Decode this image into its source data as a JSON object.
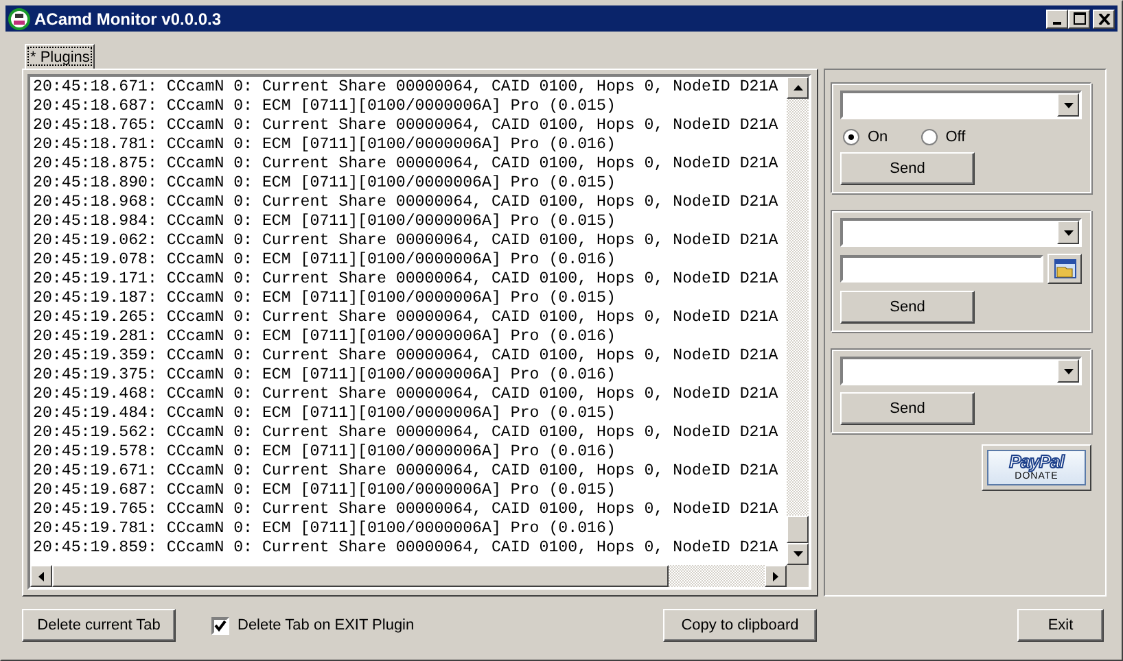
{
  "window": {
    "title": "ACamd Monitor v0.0.0.3"
  },
  "tabs": [
    {
      "label": "* Plugins",
      "selected": true
    }
  ],
  "log_lines": [
    "20:45:18.671: CCcamN 0: Current Share 00000064, CAID 0100, Hops 0, NodeID D21A",
    "20:45:18.687: CCcamN 0: ECM [0711][0100/0000006A] Pro (0.015)",
    "20:45:18.765: CCcamN 0: Current Share 00000064, CAID 0100, Hops 0, NodeID D21A",
    "20:45:18.781: CCcamN 0: ECM [0711][0100/0000006A] Pro (0.016)",
    "20:45:18.875: CCcamN 0: Current Share 00000064, CAID 0100, Hops 0, NodeID D21A",
    "20:45:18.890: CCcamN 0: ECM [0711][0100/0000006A] Pro (0.015)",
    "20:45:18.968: CCcamN 0: Current Share 00000064, CAID 0100, Hops 0, NodeID D21A",
    "20:45:18.984: CCcamN 0: ECM [0711][0100/0000006A] Pro (0.015)",
    "20:45:19.062: CCcamN 0: Current Share 00000064, CAID 0100, Hops 0, NodeID D21A",
    "20:45:19.078: CCcamN 0: ECM [0711][0100/0000006A] Pro (0.016)",
    "20:45:19.171: CCcamN 0: Current Share 00000064, CAID 0100, Hops 0, NodeID D21A",
    "20:45:19.187: CCcamN 0: ECM [0711][0100/0000006A] Pro (0.015)",
    "20:45:19.265: CCcamN 0: Current Share 00000064, CAID 0100, Hops 0, NodeID D21A",
    "20:45:19.281: CCcamN 0: ECM [0711][0100/0000006A] Pro (0.016)",
    "20:45:19.359: CCcamN 0: Current Share 00000064, CAID 0100, Hops 0, NodeID D21A",
    "20:45:19.375: CCcamN 0: ECM [0711][0100/0000006A] Pro (0.016)",
    "20:45:19.468: CCcamN 0: Current Share 00000064, CAID 0100, Hops 0, NodeID D21A",
    "20:45:19.484: CCcamN 0: ECM [0711][0100/0000006A] Pro (0.015)",
    "20:45:19.562: CCcamN 0: Current Share 00000064, CAID 0100, Hops 0, NodeID D21A",
    "20:45:19.578: CCcamN 0: ECM [0711][0100/0000006A] Pro (0.016)",
    "20:45:19.671: CCcamN 0: Current Share 00000064, CAID 0100, Hops 0, NodeID D21A",
    "20:45:19.687: CCcamN 0: ECM [0711][0100/0000006A] Pro (0.015)",
    "20:45:19.765: CCcamN 0: Current Share 00000064, CAID 0100, Hops 0, NodeID D21A",
    "20:45:19.781: CCcamN 0: ECM [0711][0100/0000006A] Pro (0.016)",
    "20:45:19.859: CCcamN 0: Current Share 00000064, CAID 0100, Hops 0, NodeID D21A"
  ],
  "groups": [
    {
      "kind": "radio",
      "options": [
        {
          "label": "On",
          "selected": true
        },
        {
          "label": "Off",
          "selected": false
        }
      ],
      "button": "Send"
    },
    {
      "kind": "file",
      "button": "Send"
    },
    {
      "kind": "plain",
      "button": "Send"
    }
  ],
  "donate": {
    "brand": "PayPal",
    "label": "DONATE"
  },
  "bottom": {
    "delete_button": "Delete current Tab",
    "checkbox": {
      "label": "Delete Tab on EXIT Plugin",
      "checked": true
    },
    "copy_button": "Copy to clipboard",
    "exit_button": "Exit"
  }
}
